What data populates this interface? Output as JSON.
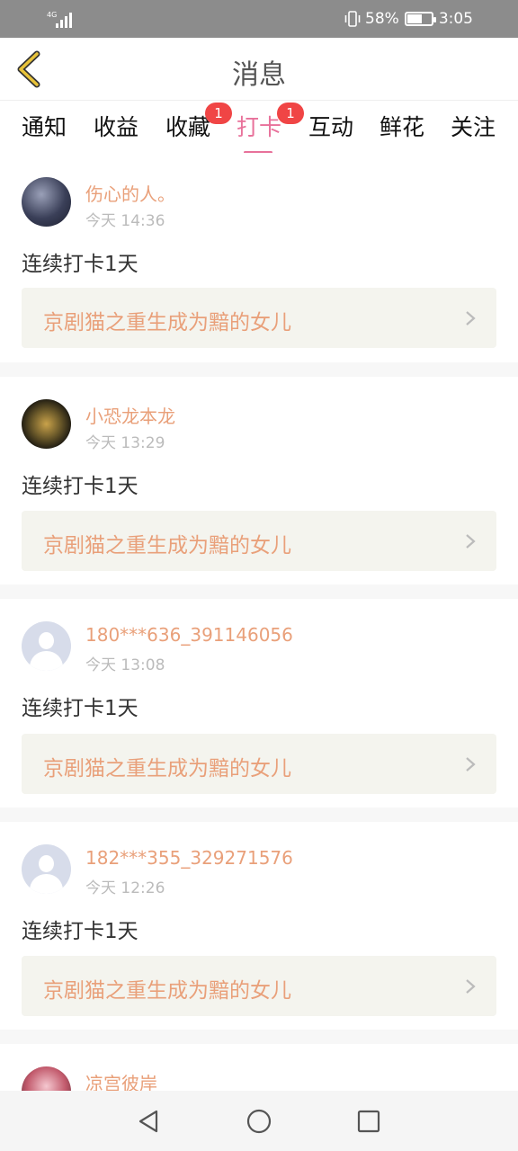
{
  "status_bar": {
    "network": "4G",
    "battery_percent": "58%",
    "battery_level": 0.58,
    "time": "3:05",
    "icons": [
      "signal-icon",
      "vibrate-icon",
      "battery-icon"
    ]
  },
  "header": {
    "title": "消息",
    "back_icon": "chevron-left-icon",
    "accent_color": "#e8c33a"
  },
  "tabs": [
    {
      "label": "通知",
      "badge": ""
    },
    {
      "label": "收益",
      "badge": ""
    },
    {
      "label": "收藏",
      "badge": "1"
    },
    {
      "label": "打卡",
      "badge": "1",
      "active": true
    },
    {
      "label": "互动",
      "badge": ""
    },
    {
      "label": "鲜花",
      "badge": ""
    },
    {
      "label": "关注",
      "badge": ""
    }
  ],
  "active_tab_color": "#e8719a",
  "posts": [
    {
      "username": "伤心的人。",
      "time": "今天 14:36",
      "content": "连续打卡1天",
      "book_title": "京剧猫之重生成为黯的女儿",
      "avatar": "photo1"
    },
    {
      "username": "小恐龙本龙",
      "time": "今天 13:29",
      "content": "连续打卡1天",
      "book_title": "京剧猫之重生成为黯的女儿",
      "avatar": "photo2"
    },
    {
      "username": "180***636_391146056",
      "time": "今天 13:08",
      "content": "连续打卡1天",
      "book_title": "京剧猫之重生成为黯的女儿",
      "avatar": "default"
    },
    {
      "username": "182***355_329271576",
      "time": "今天 12:26",
      "content": "连续打卡1天",
      "book_title": "京剧猫之重生成为黯的女儿",
      "avatar": "default"
    },
    {
      "username": "凉宫彼岸",
      "time": "",
      "content": "",
      "book_title": "",
      "avatar": "photo3"
    }
  ],
  "nav_bar": {
    "icons": [
      "back-triangle-icon",
      "home-circle-icon",
      "recents-square-icon"
    ]
  }
}
